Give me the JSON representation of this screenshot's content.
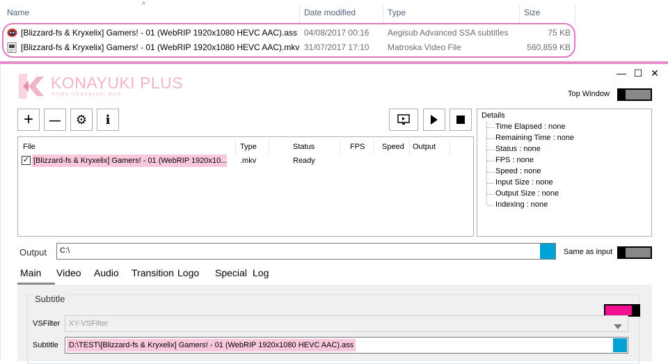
{
  "explorer": {
    "columns": {
      "name": "Name",
      "date": "Date modified",
      "type": "Type",
      "size": "Size"
    },
    "files": [
      {
        "name": "[Blizzard-fs & Kryxelix] Gamers! - 01 (WebRIP 1920x1080 HEVC AAC).ass",
        "date": "04/08/2017 00:16",
        "type": "Aegisub Advanced SSA subtitles",
        "size": "75 KB",
        "icon": "aegisub-file-icon"
      },
      {
        "name": "[Blizzard-fs & Kryxelix] Gamers! - 01 (WebRIP 1920x1080 HEVC AAC).mkv",
        "date": "31/07/2017 17:10",
        "type": "Matroska Video File",
        "size": "560,859 KB",
        "icon": "video-file-icon"
      }
    ]
  },
  "app": {
    "logo_text": "KONAYUKI PLUS",
    "logo_url": "https://konayuki.moe",
    "brand_color": "#f2b3c9",
    "accent_color": "#00a2d8",
    "window_buttons": {
      "minimize": "—",
      "maximize": "☐",
      "close": "✕"
    },
    "top_window_label": "Top Window",
    "toolbar": {
      "add": "+",
      "remove": "—",
      "settings": "⚙",
      "info": "i"
    },
    "list": {
      "headers": {
        "file": "File",
        "type": "Type",
        "status": "Status",
        "fps": "FPS",
        "speed": "Speed",
        "output": "Output"
      },
      "rows": [
        {
          "checked": true,
          "file": "[Blizzard-fs & Kryxelix] Gamers! - 01 (WebRIP 1920x10...",
          "type": ".mkv",
          "status": "Ready",
          "fps": "",
          "speed": "",
          "output": ""
        }
      ]
    },
    "details": {
      "title": "Details",
      "items": [
        "Time Elapsed : none",
        "Remaining Time : none",
        "Status : none",
        "FPS : none",
        "Speed : none",
        "Input Size : none",
        "Output Size : none",
        "Indexing : none"
      ]
    },
    "output": {
      "label": "Output",
      "value": "C:\\",
      "same_as_input_label": "Same as input"
    },
    "tabs": [
      "Main",
      "Video",
      "Audio",
      "Transition",
      "Logo",
      "Special",
      "Log"
    ],
    "active_tab": "Main",
    "subtitle": {
      "group_label": "Subtitle",
      "vsfilter_label": "VSFilter",
      "vsfilter_value": "XY-VSFilter",
      "subtitle_label": "Subtitle",
      "subtitle_value": "D:\\TEST\\[Blizzard-fs & Kryxelix] Gamers! - 01 (WebRIP 1920x1080 HEVC AAC).ass",
      "toggle_color": "#f01090"
    }
  }
}
